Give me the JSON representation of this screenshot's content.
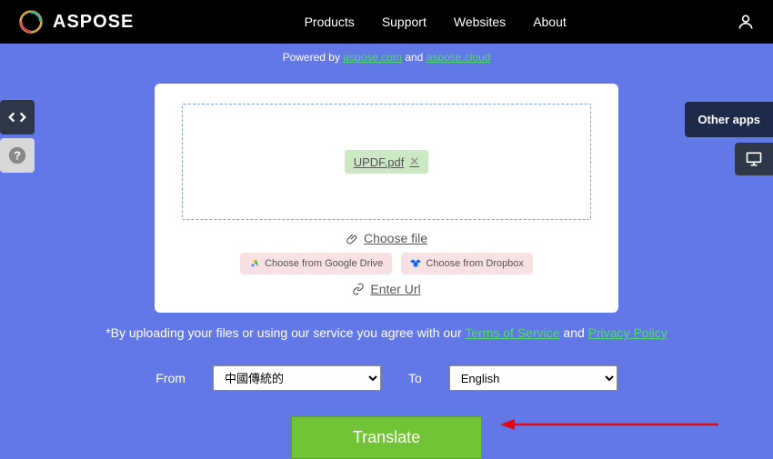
{
  "header": {
    "brand": "ASPOSE",
    "nav": [
      "Products",
      "Support",
      "Websites",
      "About"
    ]
  },
  "powered": {
    "prefix": "Powered by ",
    "link1": "aspose.com",
    "mid": " and ",
    "link2": "aspose.cloud"
  },
  "file": {
    "name": "UPDF.pdf"
  },
  "actions": {
    "choose_file": "Choose file",
    "gdrive": "Choose from Google Drive",
    "dropbox": "Choose from Dropbox",
    "enter_url": "Enter Url"
  },
  "terms": {
    "prefix": "*By uploading your files or using our service you agree with our ",
    "tos": "Terms of Service",
    "mid": " and ",
    "privacy": "Privacy Policy"
  },
  "lang": {
    "from_label": "From",
    "from_value": "中國傳統的",
    "to_label": "To",
    "to_value": "English"
  },
  "translate": "Translate",
  "other_apps": "Other apps"
}
